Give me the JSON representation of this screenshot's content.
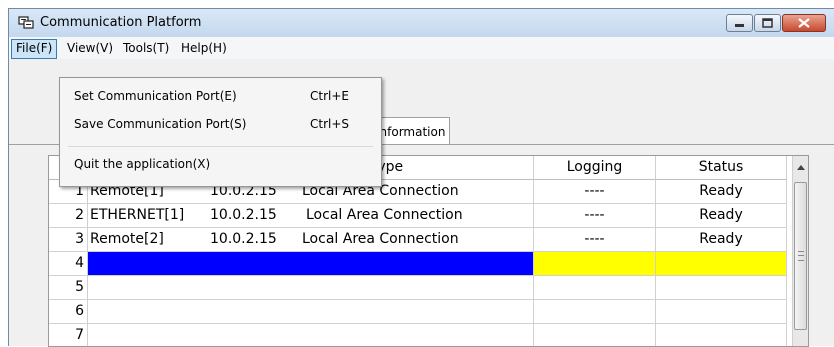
{
  "window": {
    "title": "Communication Platform"
  },
  "menu": [
    "File(F)",
    "View(V)",
    "Tools(T)",
    "Help(H)"
  ],
  "file_menu": {
    "items": [
      {
        "label": "Set Communication Port(E)",
        "shortcut": "Ctrl+E"
      },
      {
        "label": "Save Communication Port(S)",
        "shortcut": "Ctrl+S"
      },
      {
        "label": "Quit the application(X)",
        "shortcut": ""
      }
    ]
  },
  "tab": {
    "label": "Information"
  },
  "table": {
    "columns": {
      "name": "Type",
      "logging": "Logging",
      "status": "Status"
    },
    "rows": [
      {
        "num": "1",
        "name": "Remote[1]",
        "ip": "10.0.2.15",
        "type": "Local Area Connection",
        "logging": "----",
        "status": "Ready"
      },
      {
        "num": "2",
        "name": "ETHERNET[1]",
        "ip": "10.0.2.15",
        "type": "Local Area Connection",
        "logging": "----",
        "status": "Ready"
      },
      {
        "num": "3",
        "name": "Remote[2]",
        "ip": "10.0.2.15",
        "type": "Local Area Connection",
        "logging": "----",
        "status": "Ready"
      },
      {
        "num": "4",
        "name": "",
        "ip": "",
        "type": "",
        "logging": "",
        "status": ""
      },
      {
        "num": "5",
        "name": "",
        "ip": "",
        "type": "",
        "logging": "",
        "status": ""
      },
      {
        "num": "6",
        "name": "",
        "ip": "",
        "type": "",
        "logging": "",
        "status": ""
      },
      {
        "num": "7",
        "name": "",
        "ip": "",
        "type": "",
        "logging": "",
        "status": ""
      }
    ]
  },
  "colors": {
    "selection": "#0000ff",
    "highlight": "#ffff00",
    "titlebar": "#c4d8ee",
    "close": "#c74a2f"
  }
}
